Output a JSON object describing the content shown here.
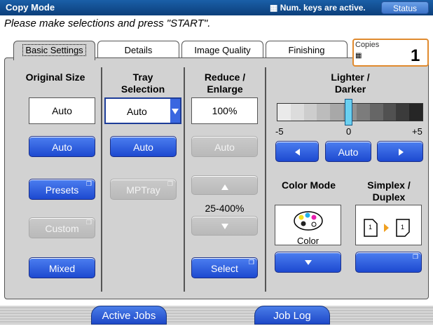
{
  "header": {
    "title": "Copy Mode",
    "num_keys": "Num. keys are active.",
    "status_label": "Status",
    "instruction": "Please make selections and press \"START\"."
  },
  "tabs": [
    {
      "label": "Basic Settings",
      "active": true
    },
    {
      "label": "Details",
      "active": false
    },
    {
      "label": "Image Quality",
      "active": false
    },
    {
      "label": "Finishing",
      "active": false
    }
  ],
  "copies": {
    "label": "Copies",
    "value": "1"
  },
  "original_size": {
    "heading": "Original Size",
    "value": "Auto",
    "buttons": {
      "auto": "Auto",
      "presets": "Presets",
      "custom": "Custom",
      "mixed": "Mixed"
    }
  },
  "tray": {
    "heading_line1": "Tray",
    "heading_line2": "Selection",
    "value": "Auto",
    "buttons": {
      "auto": "Auto",
      "mptray": "MPTray"
    }
  },
  "reduce": {
    "heading_line1": "Reduce /",
    "heading_line2": "Enlarge",
    "value": "100%",
    "buttons": {
      "auto": "Auto",
      "select": "Select"
    },
    "range": "25-400%"
  },
  "lighter": {
    "heading_line1": "Lighter /",
    "heading_line2": "Darker",
    "min_label": "-5",
    "zero_label": "0",
    "max_label": "+5",
    "level": 0,
    "auto_label": "Auto"
  },
  "color_mode": {
    "heading": "Color Mode",
    "value": "Color"
  },
  "simplex": {
    "heading_line1": "Simplex /",
    "heading_line2": "Duplex",
    "page_a": "1",
    "page_b": "1"
  },
  "footer": {
    "active_jobs": "Active Jobs",
    "job_log": "Job Log"
  },
  "colors": {
    "accent": "#1d49d0",
    "title_bar": "#0c3f7a",
    "copies_border": "#e08a2e",
    "slider_marker": "#6ad0f0"
  }
}
